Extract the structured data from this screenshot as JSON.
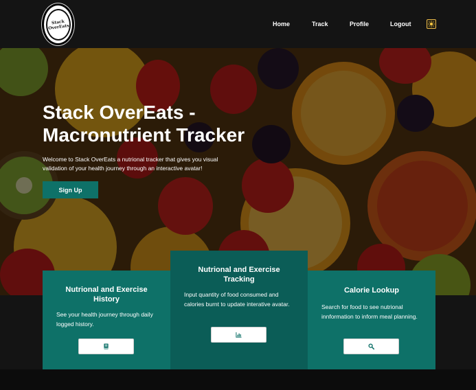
{
  "brand": {
    "logo_text": "Stack OverEats"
  },
  "nav": {
    "links": [
      "Home",
      "Track",
      "Profile",
      "Logout"
    ]
  },
  "hero": {
    "title": "Stack OverEats - Macronutrient Tracker",
    "description": "Welcome to Stack OverEats a nutrional tracker that gives you visual validation of your health journey through an interactive avatar!",
    "signup_label": "Sign Up"
  },
  "cards": [
    {
      "title": "Nutrional and Exercise History",
      "text": "See your health journey through daily logged history.",
      "icon": "book-icon"
    },
    {
      "title": "Nutrional and Exercise Tracking",
      "text": "Input quantity of food consumed and calories burnt to update interative avatar.",
      "icon": "chart-icon"
    },
    {
      "title": "Calorie Lookup",
      "text": "Search for food to see nutrional innformation to inform meal planning.",
      "icon": "search-icon"
    }
  ],
  "colors": {
    "accent": "#0e7168",
    "accent_dark": "#0b5d57",
    "navbar": "#141414",
    "toggle": "#e9b949"
  }
}
